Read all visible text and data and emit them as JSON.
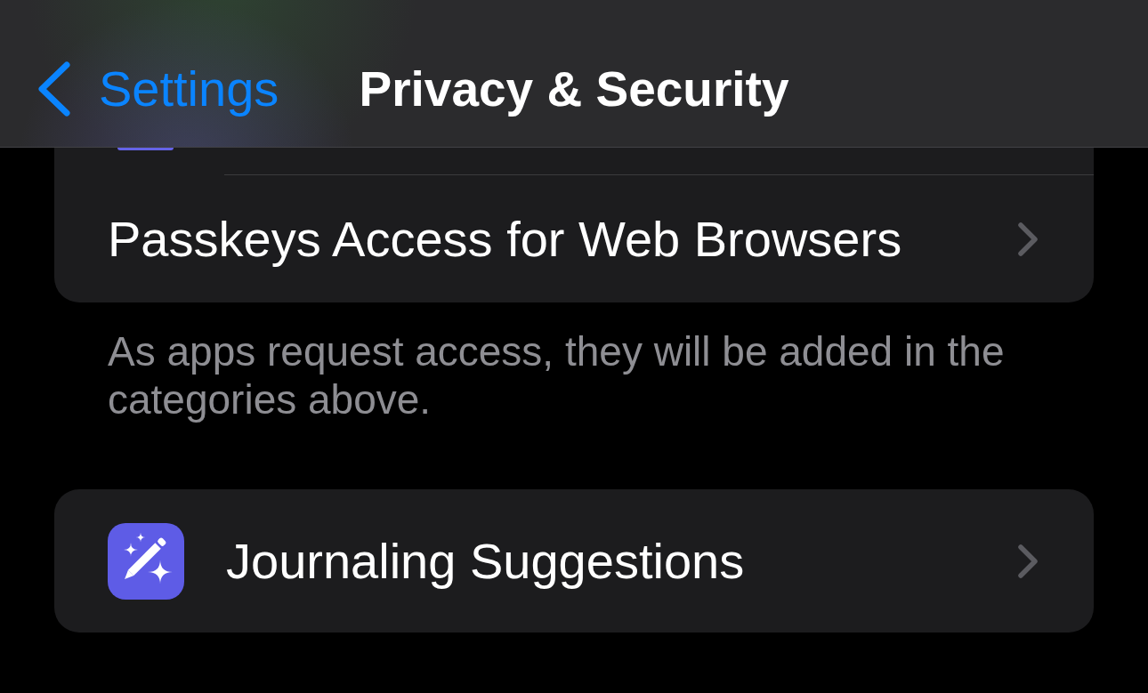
{
  "nav_bar": {
    "back_label": "Settings",
    "title": "Privacy & Security"
  },
  "groups": [
    {
      "clipped_top": true,
      "rows": [
        {
          "kind": "plain",
          "label": "Passkeys Access for Web Browsers"
        }
      ],
      "footer": "As apps request access, they will be added in the categories above."
    },
    {
      "rows": [
        {
          "kind": "icon",
          "label": "Journaling Suggestions"
        }
      ]
    }
  ]
}
